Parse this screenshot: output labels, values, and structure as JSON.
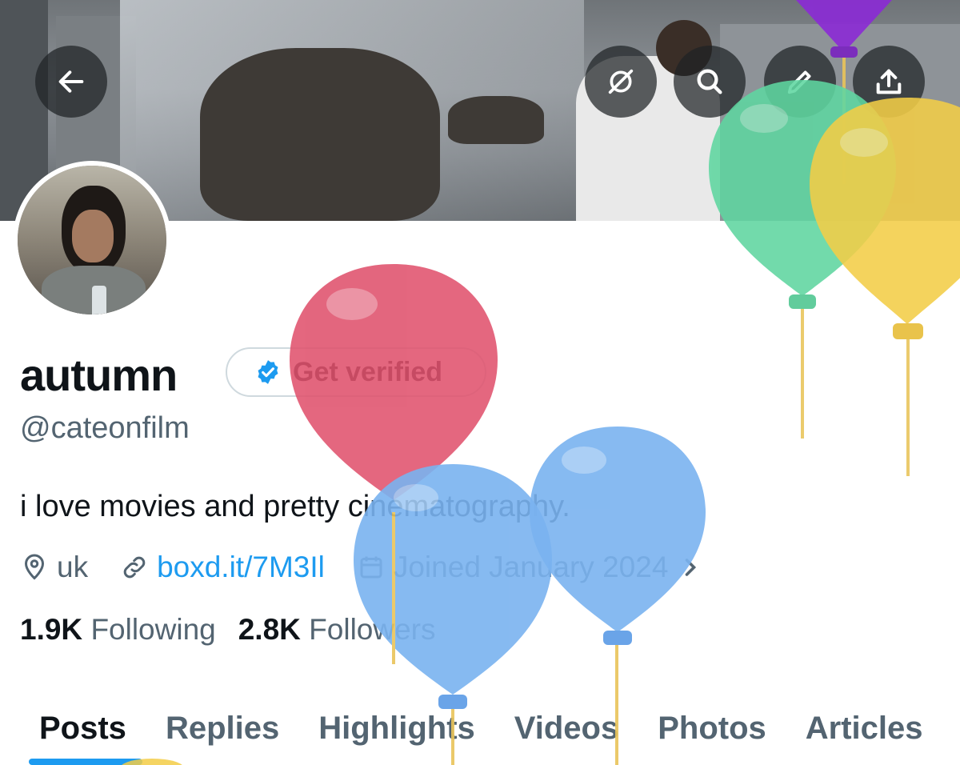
{
  "profile": {
    "display_name": "autumn",
    "handle": "@cateonfilm",
    "bio": "i love movies and pretty cinematography.",
    "location": "uk",
    "website": "boxd.it/7M3Il",
    "joined": "Joined January 2024",
    "following_count": "1.9K",
    "following_label": "Following",
    "followers_count": "2.8K",
    "followers_label": "Followers"
  },
  "verify": {
    "label": "Get verified"
  },
  "header_buttons": {
    "back": "arrow-left-icon",
    "grok": "slash-circle-icon",
    "search": "search-icon",
    "edit": "pencil-icon",
    "share": "share-icon"
  },
  "tabs": [
    "Posts",
    "Replies",
    "Highlights",
    "Videos",
    "Photos",
    "Articles"
  ],
  "colors": {
    "accent": "#1d9bf0",
    "text": "#0f1419",
    "secondary": "#536471",
    "balloon_red": "#e0526d",
    "balloon_blue": "#7ab3f0",
    "balloon_green": "#5fd6a0",
    "balloon_yellow": "#f3cd47",
    "balloon_purple": "#8b2ad6"
  }
}
